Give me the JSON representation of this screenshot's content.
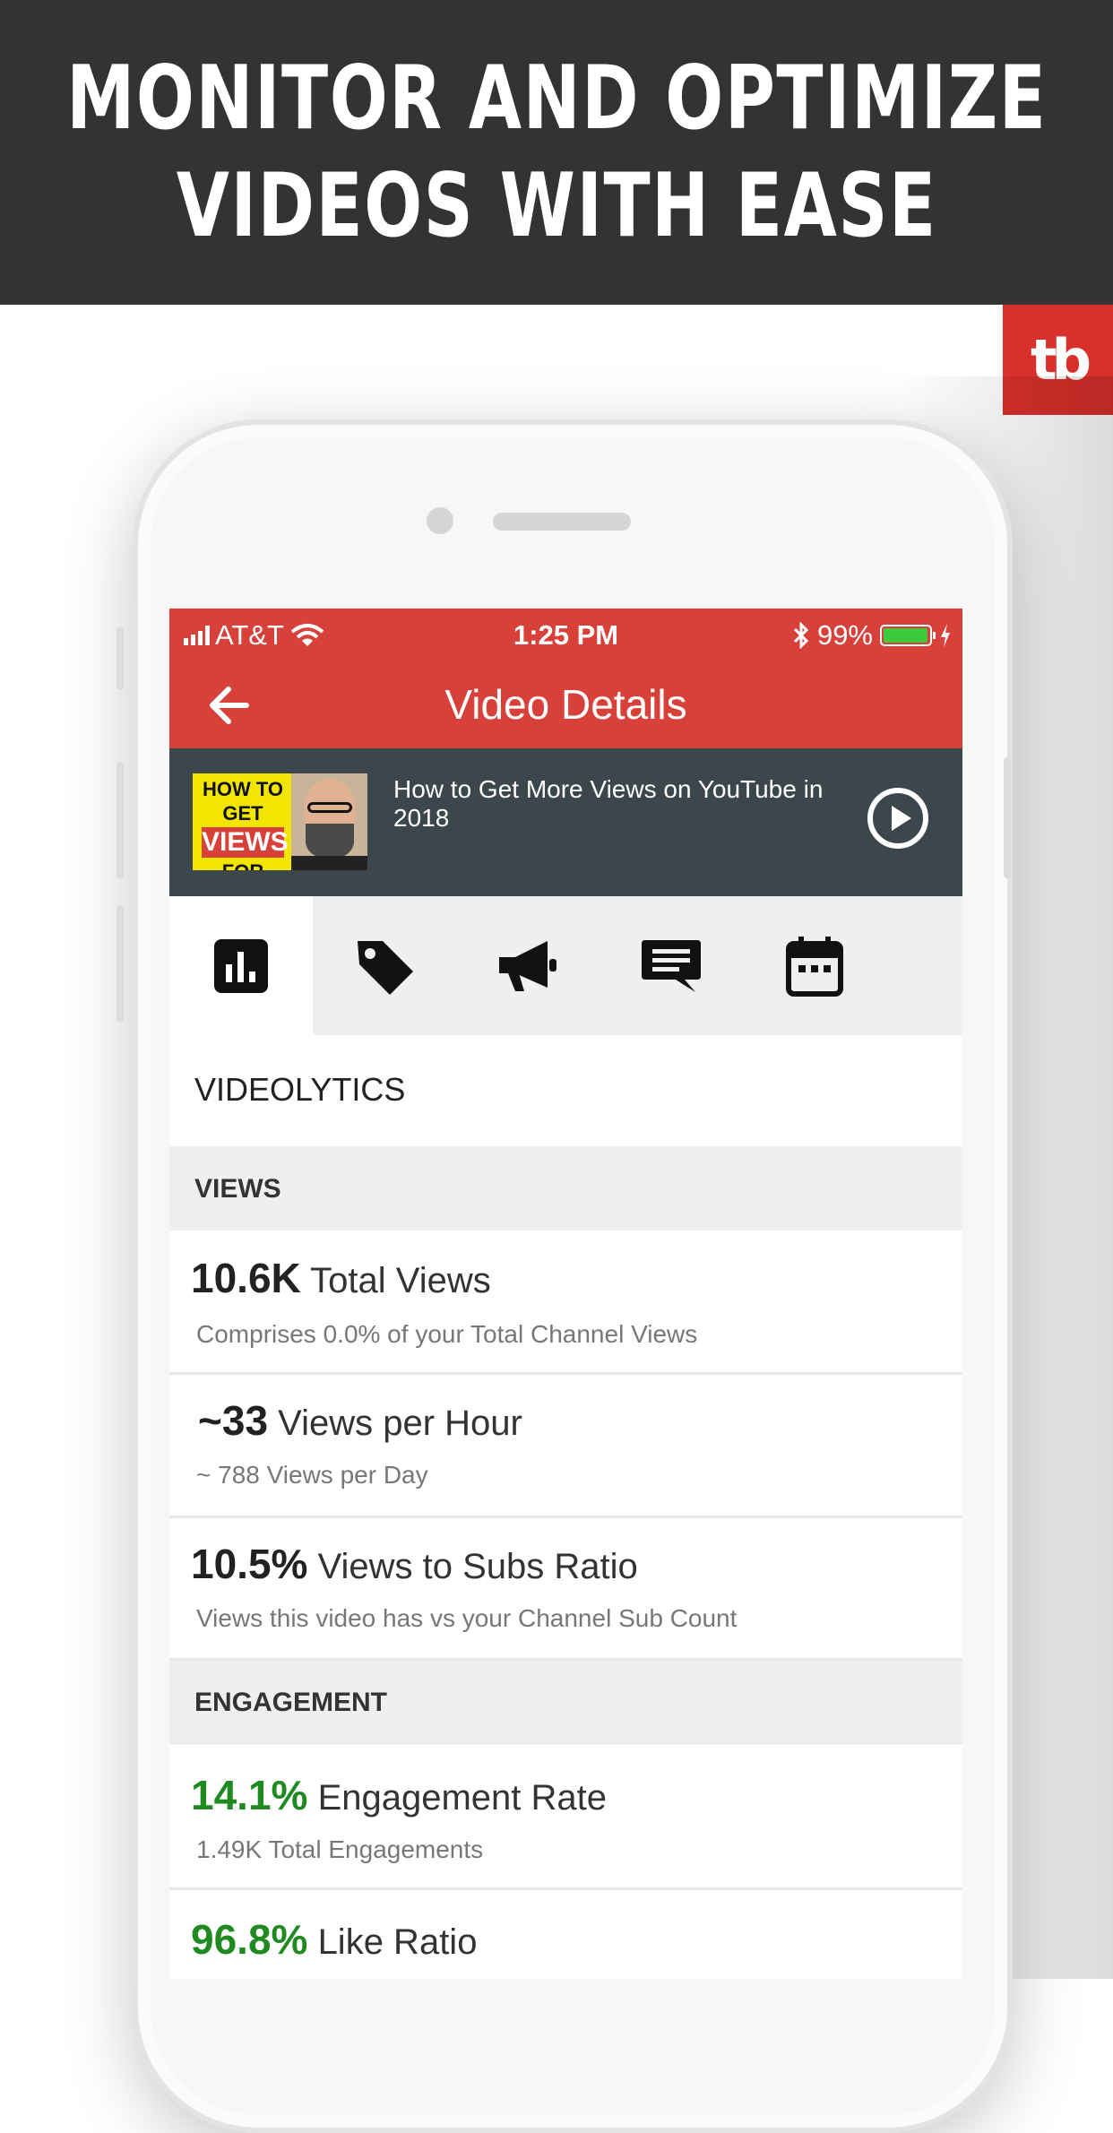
{
  "banner": {
    "line1": "MONITOR AND OPTIMIZE",
    "line2": "VIDEOS WITH EASE"
  },
  "brand": {
    "logo_text": "tb",
    "color": "#d9302b"
  },
  "status_bar": {
    "carrier": "AT&T",
    "time": "1:25 PM",
    "battery": "99%",
    "battery_level": 0.99
  },
  "header": {
    "title": "Video Details",
    "color": "#d8403a"
  },
  "video": {
    "title": "How to Get More Views on YouTube in 2018",
    "thumbnail_text": {
      "line1": "HOW TO GET",
      "line2": "VIEWS",
      "line3": "FOR REAL!"
    }
  },
  "tabs": [
    {
      "icon": "bar-chart-icon",
      "active": true
    },
    {
      "icon": "tag-icon",
      "active": false
    },
    {
      "icon": "megaphone-icon",
      "active": false
    },
    {
      "icon": "comment-icon",
      "active": false
    },
    {
      "icon": "calendar-icon",
      "active": false
    }
  ],
  "section_title": "VIDEOLYTICS",
  "groups": {
    "views": "VIEWS",
    "engagement": "ENGAGEMENT"
  },
  "metrics": [
    {
      "value": "10.6K",
      "label": "Total Views",
      "sub": "Comprises  0.0% of your Total Channel Views"
    },
    {
      "value": "~33",
      "label": "Views per Hour",
      "sub": "~ 788 Views per Day"
    },
    {
      "value": "10.5%",
      "label": "Views to Subs Ratio",
      "sub": "Views this video has vs your Channel Sub Count"
    },
    {
      "value": "14.1%",
      "label": "Engagement Rate",
      "sub": "1.49K Total Engagements"
    },
    {
      "value": "96.8%",
      "label": "Like Ratio",
      "sub": ""
    }
  ],
  "colors": {
    "positive": "#1f8a1f",
    "video_bar": "#3c474d"
  }
}
